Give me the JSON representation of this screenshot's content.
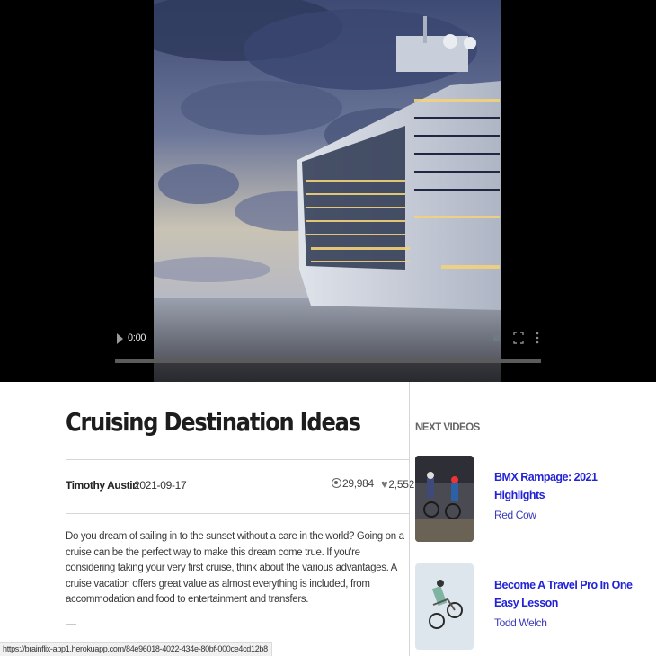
{
  "video": {
    "time": "0:00",
    "progress": 0
  },
  "article": {
    "title": "Cruising Destination Ideas",
    "author": "Timothy Austin",
    "date": "2021-09-17",
    "views": "29,984",
    "likes": "2,552",
    "body": "Do you dream of sailing in to the sunset without a care in the world? Going on a cruise can be the perfect way to make this dream come true. If you're considering taking your very first cruise, think about the various advantages. A cruise vacation offers great value as almost everything is included, from accommodation and food to entertainment and transfers.",
    "separator": "—"
  },
  "sidebar": {
    "heading": "NEXT VIDEOS",
    "items": [
      {
        "title": "BMX Rampage: 2021 Highlights",
        "author": "Red Cow",
        "thumb_icon": "bmx-riders-thumbnail"
      },
      {
        "title": "Become A Travel Pro In One Easy Lesson",
        "author": "Todd Welch",
        "thumb_icon": "bmx-jump-thumbnail"
      }
    ]
  },
  "status_bar": {
    "url": "https://brainflix-app1.herokuapp.com/84e96018-4022-434e-80bf-000ce4cd12b8"
  },
  "colors": {
    "link": "#2323d6",
    "video_bg": "#000000",
    "divider": "#d6d6d6"
  }
}
